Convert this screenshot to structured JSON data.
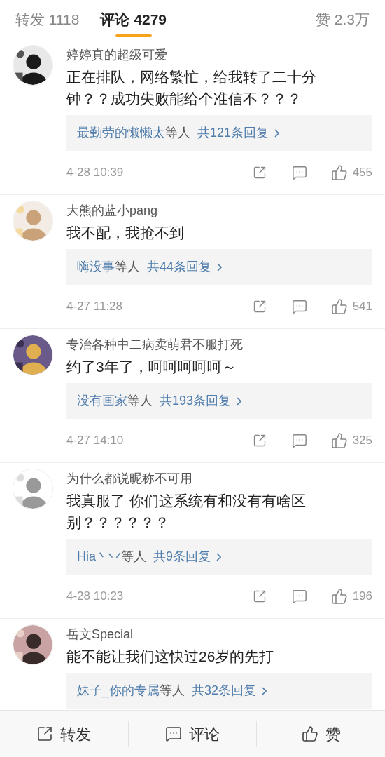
{
  "tabs": [
    {
      "label": "转发 1118",
      "selected": false
    },
    {
      "label": "评论 4279",
      "selected": true
    },
    {
      "label": "赞 2.3万",
      "selected": false
    }
  ],
  "comments": [
    {
      "name": "婷婷真的超级可爱",
      "text": "正在排队，网络繁忙，给我转了二十分钟？？成功失败能给个准信不？？？",
      "replies": {
        "replier": "最勤劳的懒懒太",
        "suffix": "等人",
        "count": "共121条回复"
      },
      "time": "4-28 10:39",
      "likes": "455"
    },
    {
      "name": "大熊的蓝小pang",
      "text": "我不配，我抢不到",
      "replies": {
        "replier": "嗨没事",
        "suffix": "等人",
        "count": "共44条回复"
      },
      "time": "4-27 11:28",
      "likes": "541"
    },
    {
      "name": "专治各种中二病卖萌君不服打死",
      "text": "约了3年了，呵呵呵呵呵～",
      "replies": {
        "replier": "没有画家",
        "suffix": "等人",
        "count": "共193条回复"
      },
      "time": "4-27 14:10",
      "likes": "325"
    },
    {
      "name": "为什么都说昵称不可用",
      "text": "我真服了 你们这系统有和没有有啥区别？？？？？？",
      "replies": {
        "replier": "Hia丶丷",
        "suffix": "等人",
        "count": "共9条回复"
      },
      "time": "4-28 10:23",
      "likes": "196"
    },
    {
      "name": "岳文Special",
      "text": "能不能让我们这快过26岁的先打",
      "replies": {
        "replier": "妹子_你的专属",
        "suffix": "等人",
        "count": "共32条回复"
      }
    }
  ],
  "bottom_bar": [
    {
      "kind": "repost",
      "label": "转发"
    },
    {
      "kind": "comment",
      "label": "评论"
    },
    {
      "kind": "like",
      "label": "赞"
    }
  ]
}
